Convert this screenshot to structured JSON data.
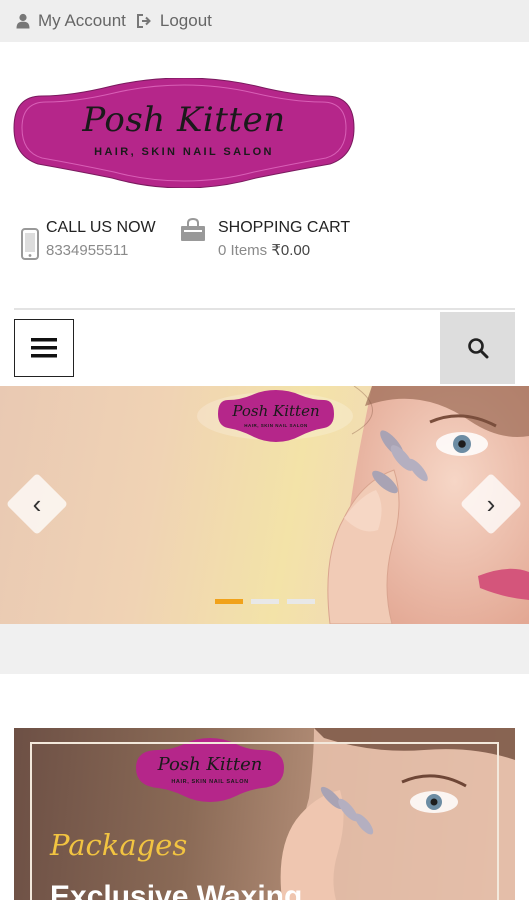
{
  "topbar": {
    "my_account": "My Account",
    "logout": "Logout"
  },
  "logo": {
    "title": "Posh Kitten",
    "subtitle": "HAIR, SKIN NAIL SALON",
    "brand_color": "#b5268a"
  },
  "contact": {
    "call_title": "CALL US NOW",
    "phone": "8334955511",
    "cart_title": "SHOPPING CART",
    "cart_items": "0 Items",
    "cart_total": "₹0.00"
  },
  "icons": {
    "user": "user-icon",
    "logout": "logout-icon",
    "phone": "mobile-phone-icon",
    "cart": "shopping-bag-icon",
    "menu": "hamburger-menu-icon",
    "search": "search-icon",
    "prev": "chevron-left-icon",
    "next": "chevron-right-icon"
  },
  "slider": {
    "logo_title": "Posh Kitten",
    "logo_subtitle": "HAIR, SKIN NAIL SALON",
    "slide_count": 3,
    "active_slide": 1,
    "prev_glyph": "‹",
    "next_glyph": "›",
    "active_color": "#f1a21a"
  },
  "promo": {
    "logo_title": "Posh Kitten",
    "logo_subtitle": "HAIR, SKIN NAIL SALON",
    "kicker": "Packages",
    "headline": "Exclusive Waxing",
    "kicker_color": "#f2c441"
  }
}
